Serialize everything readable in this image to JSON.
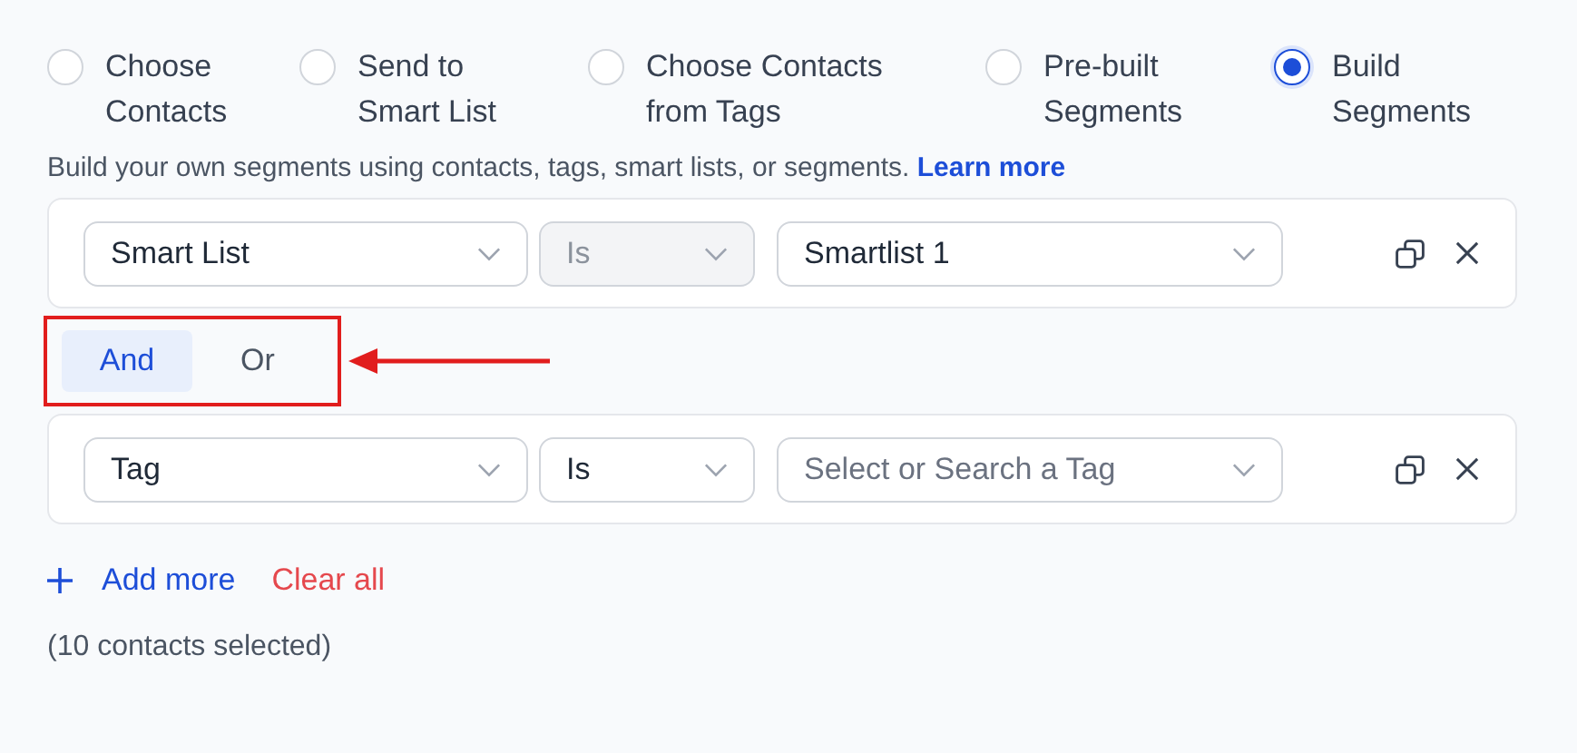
{
  "options": [
    {
      "label": "Choose Contacts",
      "selected": false
    },
    {
      "label": "Send to Smart List",
      "selected": false
    },
    {
      "label": "Choose Contacts from Tags",
      "selected": false
    },
    {
      "label": "Pre-built Segments",
      "selected": false
    },
    {
      "label": "Build Segments",
      "selected": true
    }
  ],
  "description": {
    "text": "Build your own segments using contacts, tags, smart lists, or segments.",
    "link": "Learn more"
  },
  "rules": [
    {
      "field": {
        "value": "Smart List"
      },
      "operator": {
        "value": "Is",
        "disabled": true
      },
      "target": {
        "value": "Smartlist 1"
      }
    },
    {
      "field": {
        "value": "Tag"
      },
      "operator": {
        "value": "Is",
        "disabled": false
      },
      "target": {
        "placeholder": "Select or Search a Tag"
      }
    }
  ],
  "connector": {
    "highlighted": true,
    "options": [
      {
        "label": "And",
        "selected": true
      },
      {
        "label": "Or",
        "selected": false
      }
    ]
  },
  "actions": {
    "add": "Add more",
    "clear": "Clear all"
  },
  "status": "(10 contacts selected)"
}
